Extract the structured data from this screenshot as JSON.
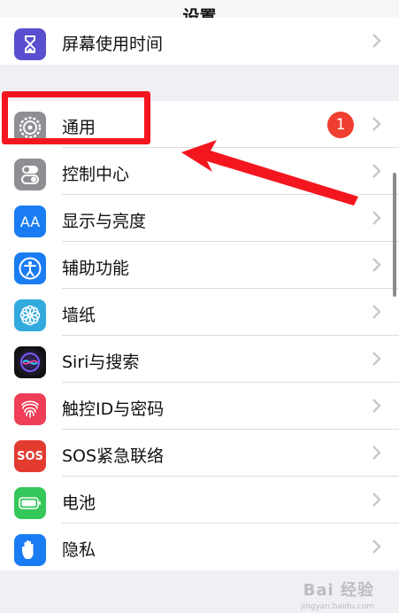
{
  "nav": {
    "title": "设置"
  },
  "rows": [
    {
      "label": "屏幕使用时间",
      "icon": "hourglass-icon",
      "color": "#5a4fcf"
    },
    {
      "label": "通用",
      "icon": "gear-icon",
      "color": "#8e8e93",
      "badge": "1"
    },
    {
      "label": "控制中心",
      "icon": "toggles-icon",
      "color": "#8e8e93"
    },
    {
      "label": "显示与亮度",
      "icon": "text-size-icon",
      "color": "#1a7cf2"
    },
    {
      "label": "辅助功能",
      "icon": "accessibility-icon",
      "color": "#1a7cf2"
    },
    {
      "label": "墙纸",
      "icon": "flower-icon",
      "color": "#33aadd"
    },
    {
      "label": "Siri与搜索",
      "icon": "siri-icon",
      "color": "#1c1c3c"
    },
    {
      "label": "触控ID与密码",
      "icon": "fingerprint-icon",
      "color": "#ef3e57"
    },
    {
      "label": "SOS紧急联络",
      "icon": "sos-icon",
      "color": "#e33b30",
      "icon_text": "SOS"
    },
    {
      "label": "电池",
      "icon": "battery-icon",
      "color": "#34c759"
    },
    {
      "label": "隐私",
      "icon": "hand-icon",
      "color": "#1a7cf2"
    }
  ],
  "icon_text": {
    "display": "AA"
  },
  "watermark": {
    "text": "Bai 经验",
    "sub": "jingyan.baidu.com"
  },
  "annotation": {
    "color": "#f4161f"
  }
}
